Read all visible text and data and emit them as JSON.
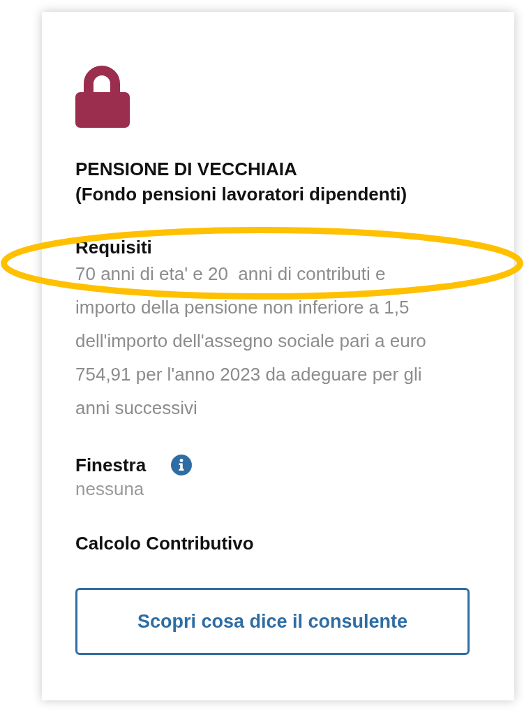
{
  "card": {
    "title": "PENSIONE DI VECCHIAIA",
    "subtitle": "(Fondo pensioni lavoratori dipendenti)"
  },
  "requirements": {
    "label": "Requisiti",
    "text": "70 anni di eta' e 20  anni di contributi e importo della pensione non inferiore a 1,5 dell'importo dell'assegno sociale pari a euro 754,91 per l'anno 2023 da adeguare per gli anni successivi",
    "highlighted": true
  },
  "window_period": {
    "label": "Finestra",
    "value": "nessuna"
  },
  "calculation": {
    "label": "Calcolo Contributivo"
  },
  "button": {
    "label": "Scopri cosa dice il consulente"
  }
}
